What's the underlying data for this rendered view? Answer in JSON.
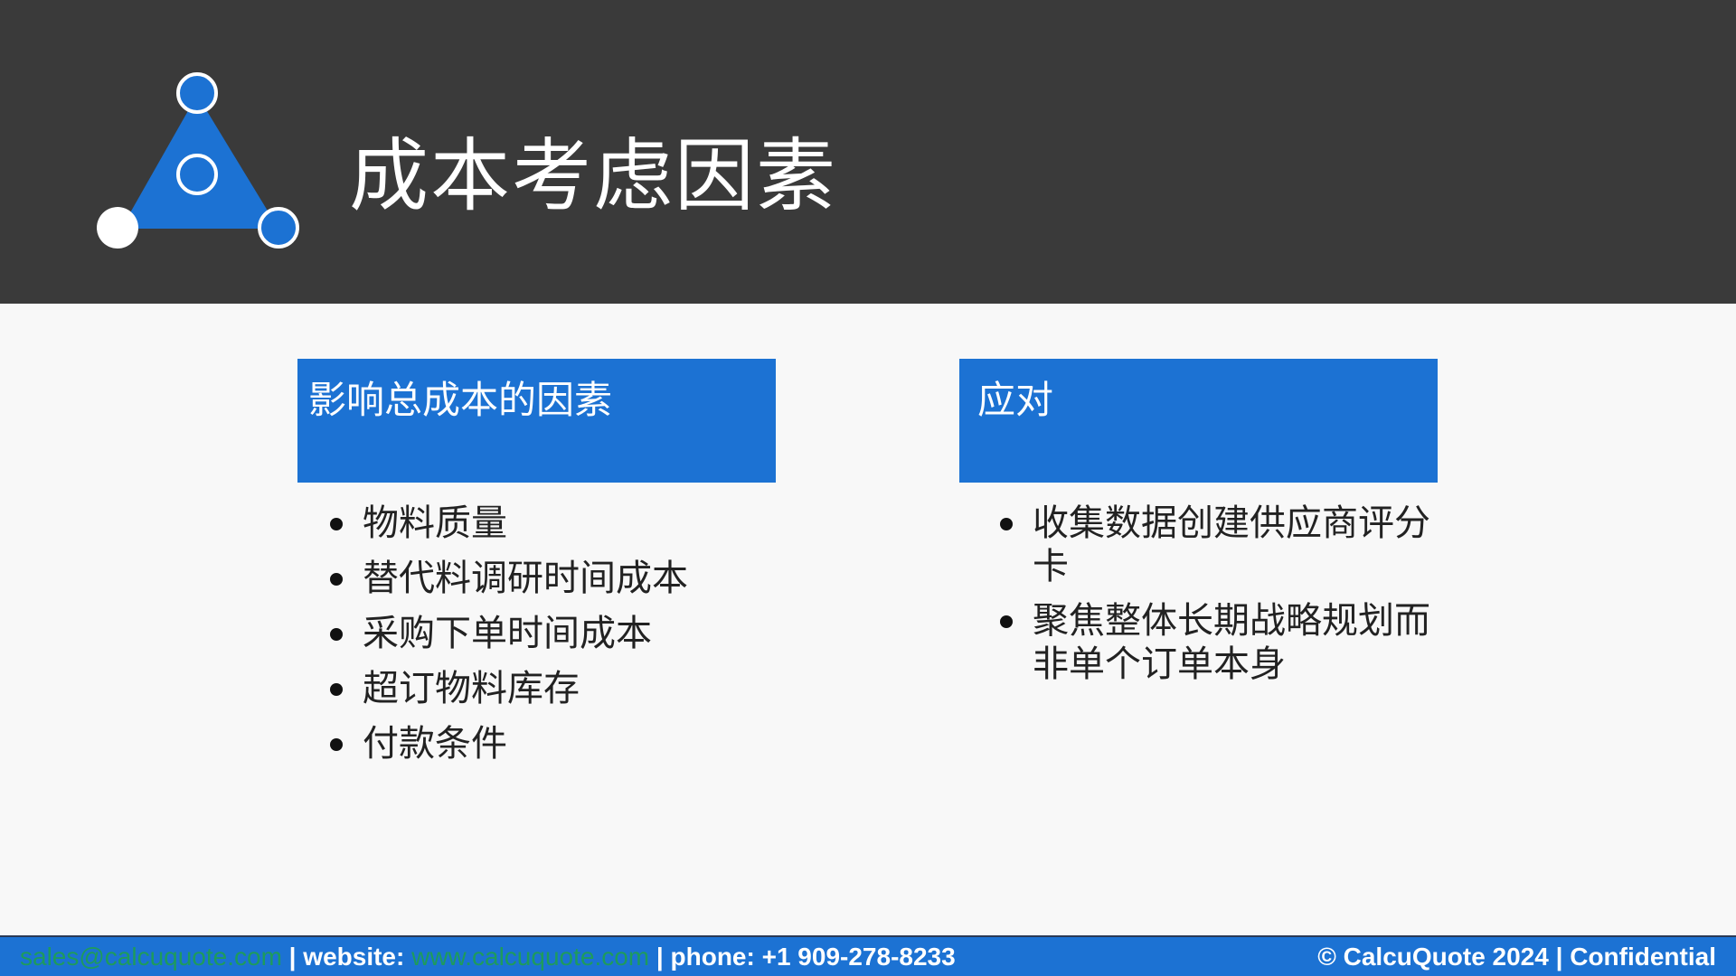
{
  "header": {
    "title": "成本考虑因素",
    "logo": "triangle-network-logo-icon"
  },
  "left_column": {
    "heading": "影响总成本的因素",
    "items": [
      "物料质量",
      "替代料调研时间成本",
      "采购下单时间成本",
      "超订物料库存",
      "付款条件"
    ]
  },
  "right_column": {
    "heading": "应对",
    "items": [
      "收集数据创建供应商评分卡",
      "聚焦整体长期战略规划而非单个订单本身"
    ]
  },
  "footer": {
    "email": "sales@calcuquote.com",
    "sep1": " | website: ",
    "website": "www.calcuquote.com",
    "phone": " | phone: +1 909-278-8233",
    "copyright": "© CalcuQuote 2024 | Confidential"
  },
  "colors": {
    "header_bg": "#3a3a3a",
    "accent_blue": "#1c72d3",
    "link_green": "#1e9b5c",
    "page_bg": "#f8f8f8"
  }
}
